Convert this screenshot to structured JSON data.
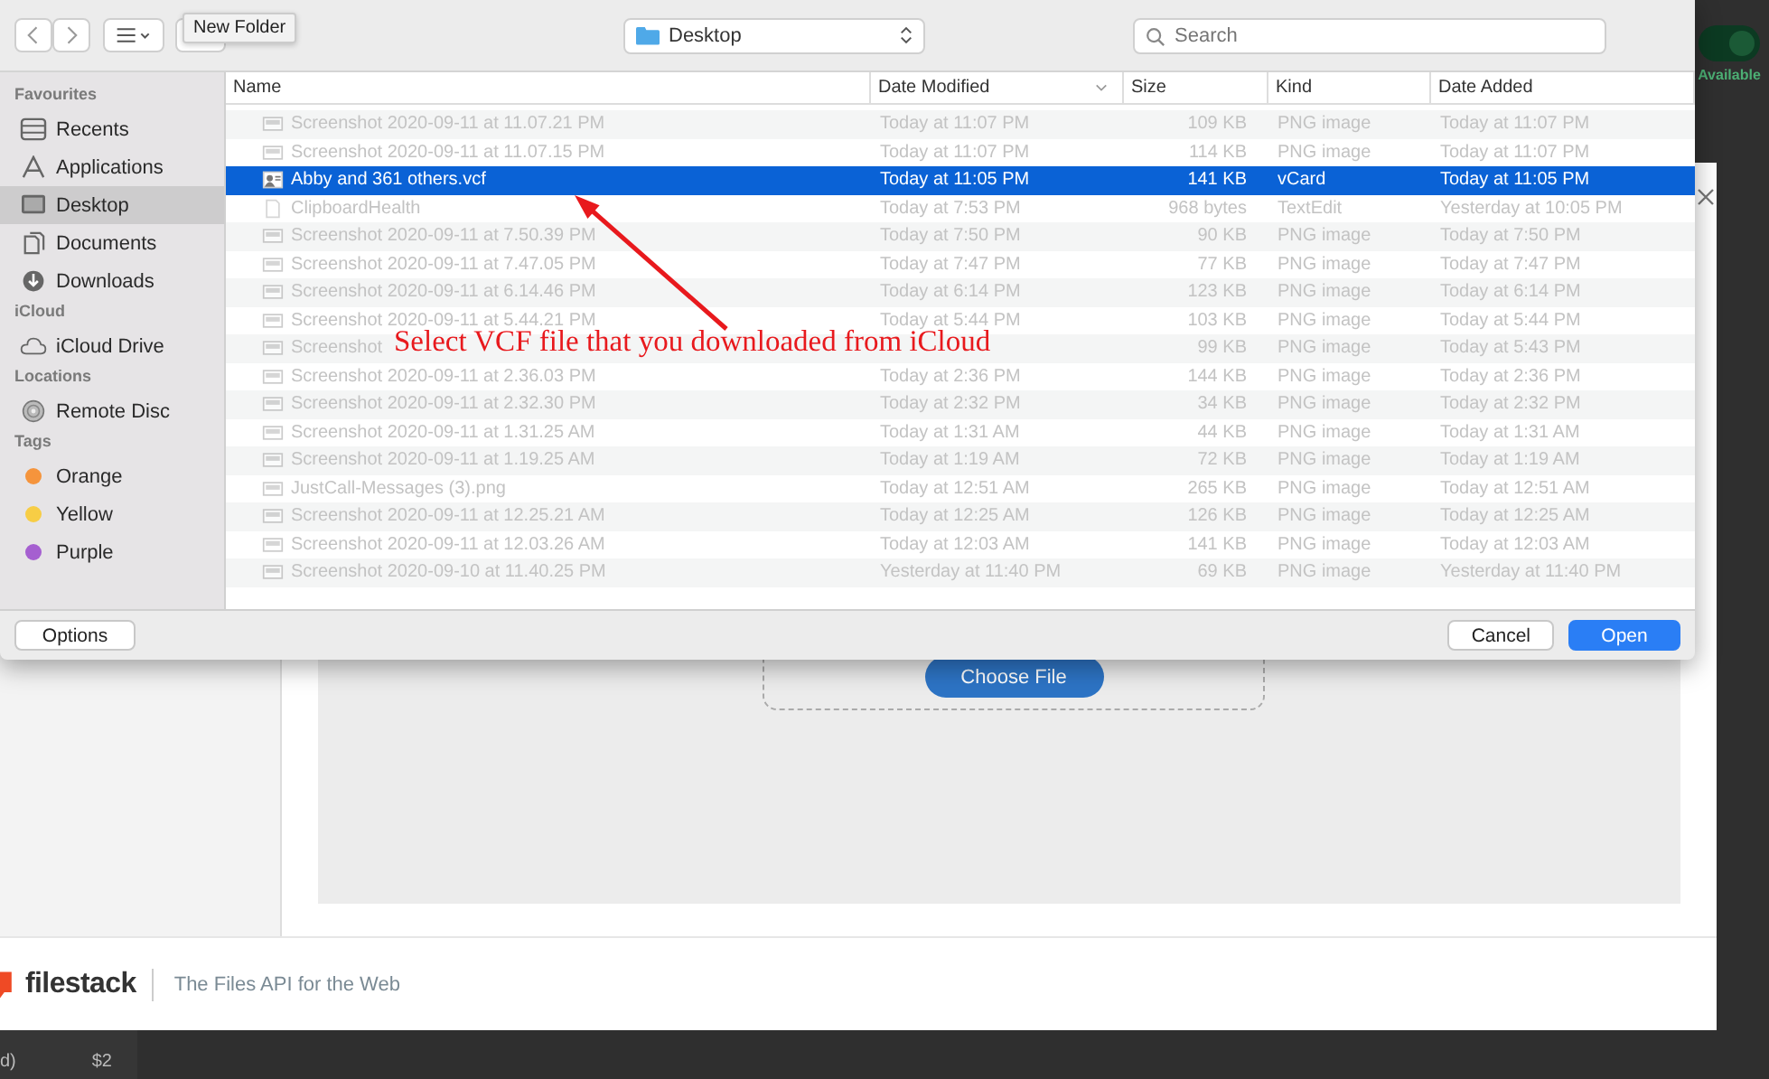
{
  "background": {
    "status": {
      "label": "Available",
      "on": true
    },
    "modal": {
      "choose_button": "Choose File",
      "footer": {
        "brand": "filestack",
        "tagline": "The Files API for the Web"
      }
    },
    "bottom_bar": [
      "d)",
      "$2"
    ]
  },
  "dialog": {
    "toolbar": {
      "tooltip": "New Folder",
      "location": "Desktop",
      "search": {
        "placeholder": "Search"
      }
    },
    "sidebar": [
      {
        "heading": "Favourites",
        "items": [
          {
            "label": "Recents",
            "kind": "recents",
            "selected": false
          },
          {
            "label": "Applications",
            "kind": "applications",
            "selected": false
          },
          {
            "label": "Desktop",
            "kind": "desktop",
            "selected": true
          },
          {
            "label": "Documents",
            "kind": "documents",
            "selected": false
          },
          {
            "label": "Downloads",
            "kind": "downloads",
            "selected": false
          }
        ]
      },
      {
        "heading": "iCloud",
        "items": [
          {
            "label": "iCloud Drive",
            "kind": "cloud",
            "selected": false
          }
        ]
      },
      {
        "heading": "Locations",
        "items": [
          {
            "label": "Remote Disc",
            "kind": "disc",
            "selected": false
          }
        ]
      },
      {
        "heading": "Tags",
        "items": [
          {
            "label": "Orange",
            "kind": "tag",
            "color": "#f5943c",
            "selected": false
          },
          {
            "label": "Yellow",
            "kind": "tag",
            "color": "#f7cd45",
            "selected": false
          },
          {
            "label": "Purple",
            "kind": "tag",
            "color": "#a55fd0",
            "selected": false
          }
        ]
      }
    ],
    "columns": [
      {
        "label": "Name",
        "sorted": false
      },
      {
        "label": "Date Modified",
        "sorted": true
      },
      {
        "label": "Size",
        "sorted": false
      },
      {
        "label": "Kind",
        "sorted": false
      },
      {
        "label": "Date Added",
        "sorted": false
      }
    ],
    "rows": [
      {
        "kind": "screenshot",
        "name": "Screenshot 2020-09-11 at 11.07.21 PM",
        "date_modified": "Today at 11:07 PM",
        "size": "109 KB",
        "file_type": "PNG image",
        "date_added": "Today at 11:07 PM",
        "selected": false,
        "disabled": true
      },
      {
        "kind": "screenshot",
        "name": "Screenshot 2020-09-11 at 11.07.15 PM",
        "date_modified": "Today at 11:07 PM",
        "size": "114 KB",
        "file_type": "PNG image",
        "date_added": "Today at 11:07 PM",
        "selected": false,
        "disabled": true
      },
      {
        "kind": "vcard",
        "name": "Abby and 361 others.vcf",
        "date_modified": "Today at 11:05 PM",
        "size": "141 KB",
        "file_type": "vCard",
        "date_added": "Today at 11:05 PM",
        "selected": true,
        "disabled": false
      },
      {
        "kind": "document",
        "name": "ClipboardHealth",
        "date_modified": "Today at 7:53 PM",
        "size": "968 bytes",
        "file_type": "TextEdit",
        "date_added": "Yesterday at 10:05 PM",
        "selected": false,
        "disabled": true
      },
      {
        "kind": "screenshot",
        "name": "Screenshot 2020-09-11 at 7.50.39 PM",
        "date_modified": "Today at 7:50 PM",
        "size": "90 KB",
        "file_type": "PNG image",
        "date_added": "Today at 7:50 PM",
        "selected": false,
        "disabled": true
      },
      {
        "kind": "screenshot",
        "name": "Screenshot 2020-09-11 at 7.47.05 PM",
        "date_modified": "Today at 7:47 PM",
        "size": "77 KB",
        "file_type": "PNG image",
        "date_added": "Today at 7:47 PM",
        "selected": false,
        "disabled": true
      },
      {
        "kind": "screenshot",
        "name": "Screenshot 2020-09-11 at 6.14.46 PM",
        "date_modified": "Today at 6:14 PM",
        "size": "123 KB",
        "file_type": "PNG image",
        "date_added": "Today at 6:14 PM",
        "selected": false,
        "disabled": true
      },
      {
        "kind": "screenshot",
        "name": "Screenshot 2020-09-11 at 5.44.21 PM",
        "date_modified": "Today at 5:44 PM",
        "size": "103 KB",
        "file_type": "PNG image",
        "date_added": "Today at 5:44 PM",
        "selected": false,
        "disabled": true
      },
      {
        "kind": "screenshot",
        "name": "Screenshot",
        "size": "99 KB",
        "file_type": "PNG image",
        "date_added": "Today at 5:43 PM",
        "selected": false,
        "disabled": true
      },
      {
        "kind": "screenshot",
        "name": "Screenshot 2020-09-11 at 2.36.03 PM",
        "date_modified": "Today at 2:36 PM",
        "size": "144 KB",
        "file_type": "PNG image",
        "date_added": "Today at 2:36 PM",
        "selected": false,
        "disabled": true
      },
      {
        "kind": "screenshot",
        "name": "Screenshot 2020-09-11 at 2.32.30 PM",
        "date_modified": "Today at 2:32 PM",
        "size": "34 KB",
        "file_type": "PNG image",
        "date_added": "Today at 2:32 PM",
        "selected": false,
        "disabled": true
      },
      {
        "kind": "screenshot",
        "name": "Screenshot 2020-09-11 at 1.31.25 AM",
        "date_modified": "Today at 1:31 AM",
        "size": "44 KB",
        "file_type": "PNG image",
        "date_added": "Today at 1:31 AM",
        "selected": false,
        "disabled": true
      },
      {
        "kind": "screenshot",
        "name": "Screenshot 2020-09-11 at 1.19.25 AM",
        "date_modified": "Today at 1:19 AM",
        "size": "72 KB",
        "file_type": "PNG image",
        "date_added": "Today at 1:19 AM",
        "selected": false,
        "disabled": true
      },
      {
        "kind": "screenshot",
        "name": "JustCall-Messages (3).png",
        "date_modified": "Today at 12:51 AM",
        "size": "265 KB",
        "file_type": "PNG image",
        "date_added": "Today at 12:51 AM",
        "selected": false,
        "disabled": true
      },
      {
        "kind": "screenshot",
        "name": "Screenshot 2020-09-11 at 12.25.21 AM",
        "date_modified": "Today at 12:25 AM",
        "size": "126 KB",
        "file_type": "PNG image",
        "date_added": "Today at 12:25 AM",
        "selected": false,
        "disabled": true
      },
      {
        "kind": "screenshot",
        "name": "Screenshot 2020-09-11 at 12.03.26 AM",
        "date_modified": "Today at 12:03 AM",
        "size": "141 KB",
        "file_type": "PNG image",
        "date_added": "Today at 12:03 AM",
        "selected": false,
        "disabled": true
      },
      {
        "kind": "screenshot",
        "name": "Screenshot 2020-09-10 at 11.40.25 PM",
        "date_modified": "Yesterday at 11:40 PM",
        "size": "69 KB",
        "file_type": "PNG image",
        "date_added": "Yesterday at 11:40 PM",
        "selected": false,
        "disabled": true
      }
    ],
    "buttons": [
      {
        "label": "Options",
        "kind": "plain"
      },
      {
        "label": "Cancel",
        "kind": "plain"
      },
      {
        "label": "Open",
        "kind": "default"
      }
    ]
  },
  "annotation": {
    "text": "Select VCF file that you downloaded from iCloud"
  }
}
